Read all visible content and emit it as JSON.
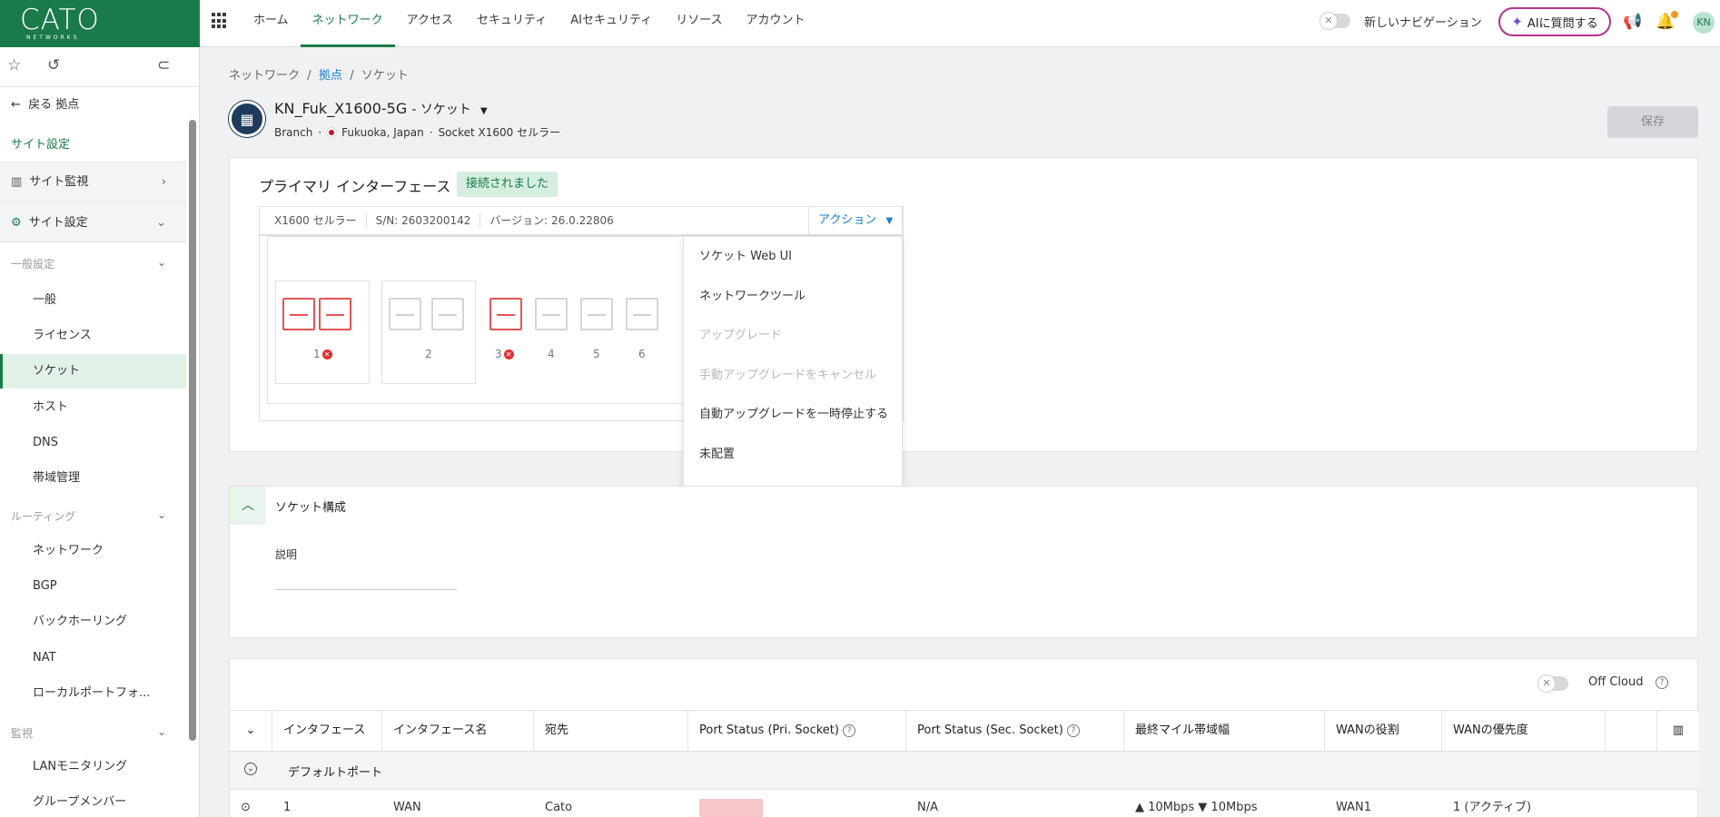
{
  "logo": {
    "main": "CATO",
    "sub": "NETWORKS"
  },
  "nav": [
    "ホーム",
    "ネットワーク",
    "アクセス",
    "セキュリティ",
    "AIセキュリティ",
    "リソース",
    "アカウント"
  ],
  "new_navigation": {
    "label": "新しいナビゲーション",
    "state": "off"
  },
  "ai_button": "AIに質問する",
  "user_initials": "KN",
  "sidebar": {
    "back": "戻る 拠点",
    "title": "サイト設定",
    "groups": {
      "monitor": "サイト監視",
      "settings": "サイト設定"
    },
    "sections": {
      "general": "一般設定",
      "routing": "ルーティング",
      "monitoring": "監視"
    },
    "general_items": [
      "一般",
      "ライセンス",
      "ソケット",
      "ホスト",
      "DNS",
      "帯域管理"
    ],
    "routing_items": [
      "ネットワーク",
      "BGP",
      "バックホーリング",
      "NAT",
      "ローカルポートフォ..."
    ],
    "monitoring_items": [
      "LANモニタリング",
      "グループメンバー"
    ],
    "active_item": "ソケット"
  },
  "breadcrumb": {
    "a": "ネットワーク",
    "b": "拠点",
    "c": "ソケット",
    "sep": "/"
  },
  "site": {
    "name": "KN_Fuk_X1600-5G",
    "suffix": "- ソケット",
    "type": "Branch",
    "location": "Fukuoka, Japan",
    "model": "Socket X1600 セルラー"
  },
  "save_label": "保存",
  "primary": {
    "title": "プライマリ インターフェース",
    "status": "接続されました",
    "device": "X1600 セルラー",
    "serial": "S/N: 2603200142",
    "version": "バージョン: 26.0.22806",
    "action_label": "アクション",
    "ports": [
      "1",
      "2",
      "3",
      "4",
      "5",
      "6"
    ]
  },
  "action_menu": [
    {
      "label": "ソケット Web UI",
      "enabled": true
    },
    {
      "label": "ネットワークツール",
      "enabled": true
    },
    {
      "label": "アップグレード",
      "enabled": false
    },
    {
      "label": "手動アップグレードをキャンセル",
      "enabled": false
    },
    {
      "label": "自動アップグレードを一時停止する",
      "enabled": true
    },
    {
      "label": "未配置",
      "enabled": true
    }
  ],
  "socket_config": {
    "title": "ソケット構成",
    "desc_label": "説明",
    "desc_value": ""
  },
  "table": {
    "off_cloud_label": "Off Cloud",
    "columns": [
      "インタフェース",
      "インタフェース名",
      "宛先",
      "Port Status (Pri. Socket)",
      "Port Status (Sec. Socket)",
      "最終マイル帯域幅",
      "WANの役割",
      "WANの優先度"
    ],
    "group_label": "デフォルトポート",
    "first_row": {
      "interface": "1",
      "name": "WAN",
      "dest": "Cato",
      "sec_status": "N/A",
      "bandwidth": "▲ 10Mbps  ▼ 10Mbps",
      "role": "WAN1",
      "priority": "1 (アクティブ)"
    }
  },
  "colors": {
    "brand": "#1a7a4a",
    "link": "#1a7fd1",
    "error": "#e25555"
  }
}
